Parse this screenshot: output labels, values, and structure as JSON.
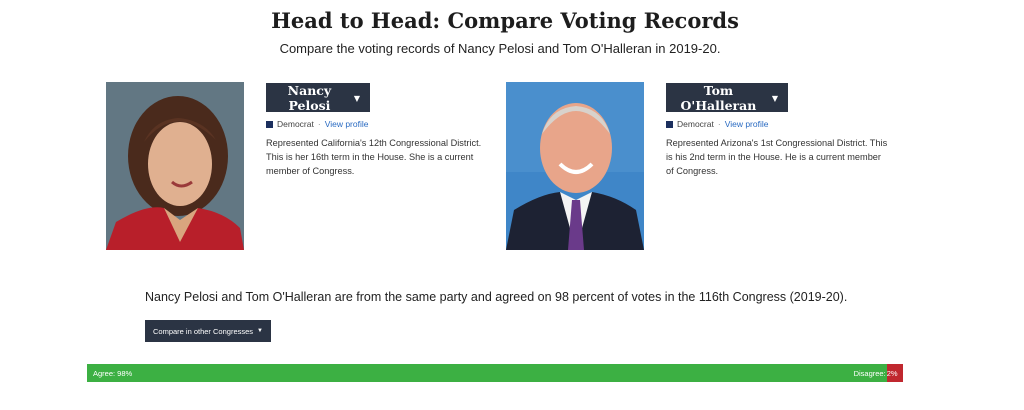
{
  "header": {
    "title": "Head to Head: Compare Voting Records",
    "subtitle": "Compare the voting records of Nancy Pelosi and Tom O'Halleran in 2019-20."
  },
  "members": [
    {
      "name": "Nancy Pelosi",
      "party": "Democrat",
      "separator": "·",
      "profile_link": "View profile",
      "description": "Represented California's 12th Congressional District. This is her 16th term in the House. She is a current member of Congress."
    },
    {
      "name": "Tom O'Halleran",
      "party": "Democrat",
      "separator": "·",
      "profile_link": "View profile",
      "description": "Represented Arizona's 1st Congressional District. This is his 2nd term in the House. He is a current member of Congress."
    }
  ],
  "summary": "Nancy Pelosi and Tom O'Halleran are from the same party and agreed on 98 percent of votes in the 116th Congress (2019-20).",
  "congress_button": "Compare in other Congresses",
  "agreement": {
    "agree_label": "Agree: 98%",
    "agree_fraction": 0.98,
    "disagree_label": "Disagree:",
    "disagree_pct": "2%",
    "disagree_fraction": 0.02
  },
  "colors": {
    "agree": "#3cb043",
    "disagree": "#c0282f",
    "democrat": "#1b2f5e",
    "button": "#2b3444"
  },
  "icons": {
    "caret": "caret-down-icon"
  }
}
